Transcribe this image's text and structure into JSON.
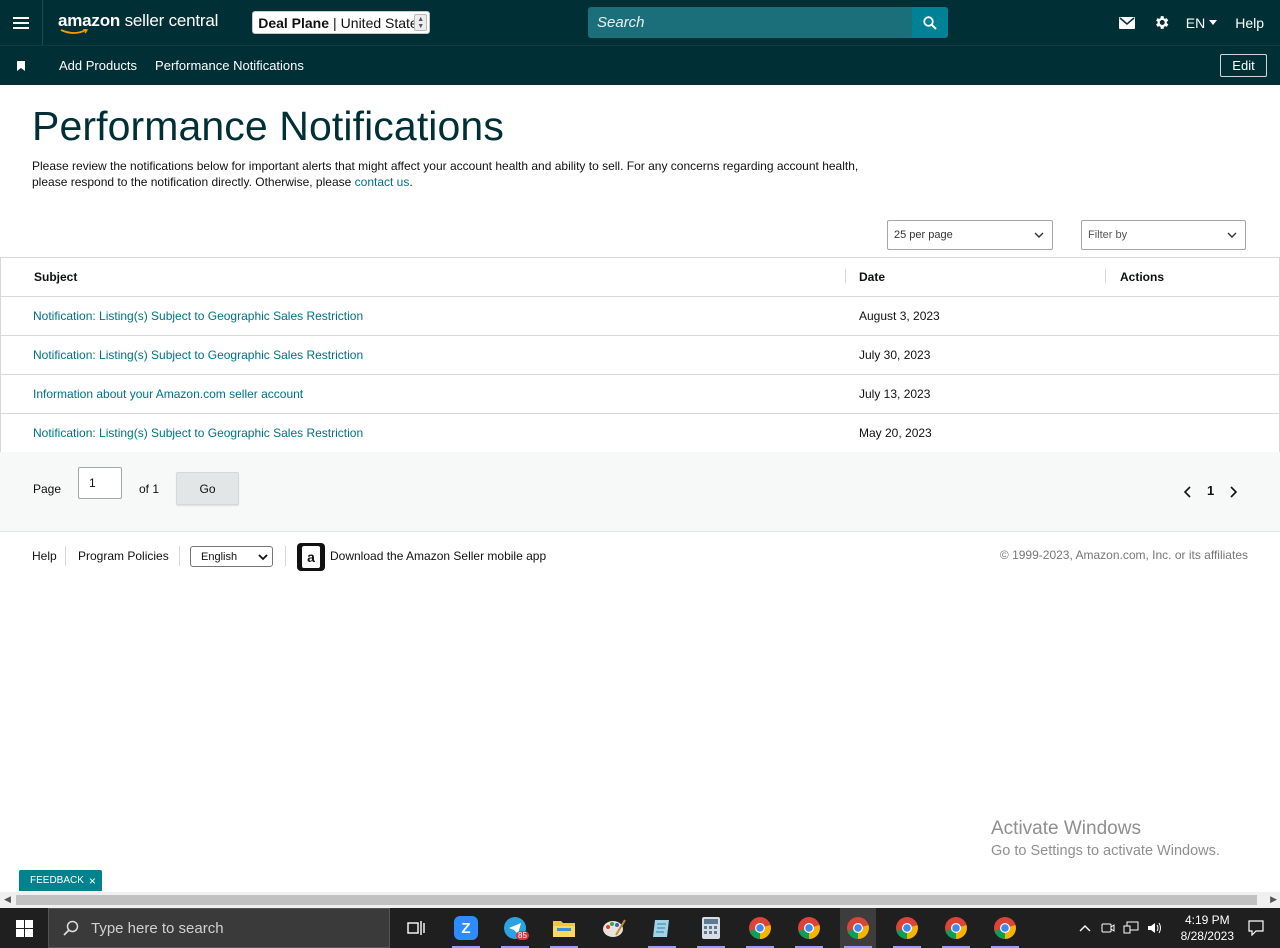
{
  "header": {
    "logo_text_bold": "amazon",
    "logo_text": "seller central",
    "store_name": "Deal Plane",
    "store_sep": "|",
    "store_region": "United States",
    "search_placeholder": "Search",
    "language": "EN",
    "help": "Help"
  },
  "nav": {
    "items": [
      {
        "label": "Add Products"
      },
      {
        "label": "Performance Notifications"
      }
    ],
    "edit": "Edit"
  },
  "page": {
    "title": "Performance Notifications",
    "intro_text": "Please review the notifications below for important alerts that might affect your account health and ability to sell. For any concerns regarding account health, please respond to the notification directly. Otherwise, please",
    "intro_link": "contact us",
    "intro_end": "."
  },
  "controls": {
    "per_page": "25 per page",
    "filter": "Filter by"
  },
  "table": {
    "headers": {
      "subject": "Subject",
      "date": "Date",
      "actions": "Actions"
    },
    "rows": [
      {
        "subject": "Notification: Listing(s) Subject to Geographic Sales Restriction",
        "date": "August 3, 2023"
      },
      {
        "subject": "Notification: Listing(s) Subject to Geographic Sales Restriction",
        "date": "July 30, 2023"
      },
      {
        "subject": "Information about your Amazon.com seller account",
        "date": "July 13, 2023"
      },
      {
        "subject": "Notification: Listing(s) Subject to Geographic Sales Restriction",
        "date": "May 20, 2023"
      }
    ]
  },
  "pagination": {
    "page_label": "Page",
    "page_value": "1",
    "of_label": "of 1",
    "go": "Go",
    "current": "1"
  },
  "footer": {
    "help": "Help",
    "policies": "Program Policies",
    "language": "English",
    "app_text": "Download the Amazon Seller mobile app",
    "copyright": "© 1999-2023, Amazon.com, Inc. or its affiliates"
  },
  "watermark": {
    "line1": "Activate Windows",
    "line2": "Go to Settings to activate Windows."
  },
  "feedback": {
    "label": "FEEDBACK",
    "close": "×"
  },
  "taskbar": {
    "search_placeholder": "Type here to search",
    "telegram_badge": "85",
    "time": "4:19 PM",
    "date": "8/28/2023",
    "apps": [
      "task-view-icon",
      "zoom-icon",
      "telegram-icon",
      "file-explorer-icon",
      "paint-icon",
      "notepad-icon",
      "calculator-icon",
      "chrome-icon",
      "chrome-icon",
      "chrome-icon",
      "chrome-icon",
      "chrome-icon",
      "chrome-icon"
    ]
  },
  "colors": {
    "header_bg": "#002f36",
    "search_bg": "#1b6f7a",
    "search_btn": "#008296",
    "link": "#007185",
    "feedback": "#00838f"
  }
}
